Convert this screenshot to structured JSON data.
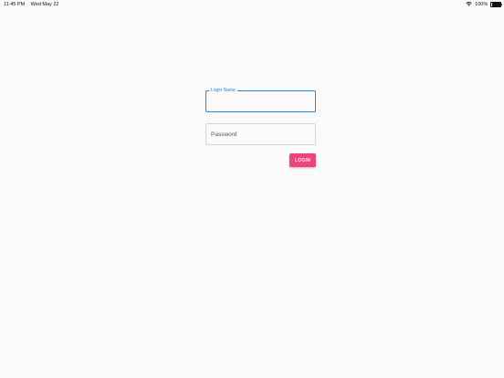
{
  "status_bar": {
    "time": "11:45 PM",
    "date": "Wed May 22",
    "battery_percent": "100%",
    "battery_level": 1.0,
    "icons": [
      "wifi-icon",
      "battery-icon"
    ]
  },
  "login_form": {
    "login_name_label": "Login Name",
    "login_name_value": "",
    "password_label": "Password",
    "password_value": "",
    "login_button_label": "LOGIN"
  },
  "colors": {
    "background": "#fafafa",
    "focus_accent": "#1e88e5",
    "button": "#f0437a",
    "button_text": "#ffffff"
  }
}
